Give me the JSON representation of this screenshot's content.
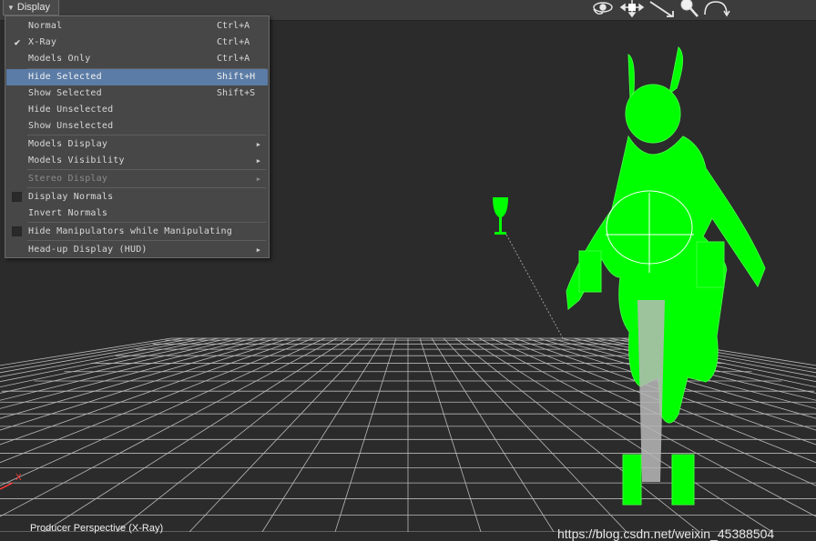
{
  "toolbar": {
    "display_label": "Display",
    "tool_icons": [
      "tumble-icon",
      "move-icon",
      "track-icon",
      "zoom-icon",
      "rotate-icon"
    ]
  },
  "menu": {
    "items": [
      {
        "label": "Normal",
        "shortcut": "Ctrl+A",
        "checked": false
      },
      {
        "label": "X-Ray",
        "shortcut": "Ctrl+A",
        "checked": true
      },
      {
        "label": "Models Only",
        "shortcut": "Ctrl+A"
      },
      {
        "label": "Hide Selected",
        "shortcut": "Shift+H",
        "highlighted": true
      },
      {
        "label": "Show Selected",
        "shortcut": "Shift+S"
      },
      {
        "label": "Hide Unselected",
        "shortcut": ""
      },
      {
        "label": "Show Unselected",
        "shortcut": ""
      },
      {
        "label": "Models Display",
        "submenu": true
      },
      {
        "label": "Models Visibility",
        "submenu": true
      },
      {
        "label": "Stereo Display",
        "submenu": true,
        "disabled": true
      },
      {
        "label": "Display Normals",
        "checkbox": true,
        "checked": false
      },
      {
        "label": "Invert Normals"
      },
      {
        "label": "Hide Manipulators while Manipulating",
        "checkbox": true,
        "checked": false
      },
      {
        "label": "Head-up Display (HUD)",
        "submenu": true
      }
    ]
  },
  "viewport": {
    "label": "Producer Perspective (X-Ray)",
    "model_color": "#00ff00",
    "grid_color": "#bdbdbd",
    "axis_x_label": "X"
  },
  "watermark": "https://blog.csdn.net/weixin_45388504"
}
